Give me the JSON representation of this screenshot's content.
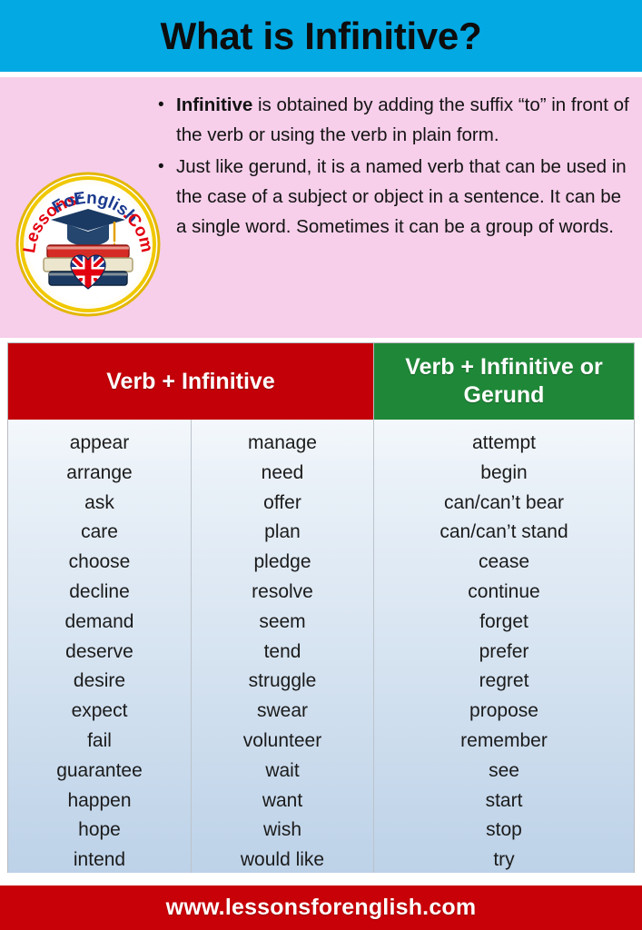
{
  "colors": {
    "title_banner_bg": "#03a9e3",
    "intro_bg": "#f7cfea",
    "header_infinitive_bg": "#c30008",
    "header_gerund_bg": "#1f8838",
    "footer_bg": "#c80007",
    "table_body_top": "#f4f8fc",
    "table_body_bottom": "#bdd2e8",
    "text_dark": "#131313",
    "text_white": "#ffffff"
  },
  "title": {
    "text": "What is Infinitive?"
  },
  "intro": {
    "bullet_glyph": "•",
    "bullets": [
      {
        "lead": "Infinitive",
        "rest": " is obtained by adding the suffix “to” in front of the verb or using the verb in plain form."
      },
      {
        "lead": "",
        "rest": "Just like gerund, it is a named verb that can be used in the case of a subject or object in a sentence. It can be a single word. Sometimes it can be a group of words."
      }
    ]
  },
  "logo": {
    "name": "lessons-for-english-logo",
    "text_red_1": "Lessons",
    "text_blue_1": "For",
    "text_blue_2": "English",
    "text_red_2": ".Com",
    "curved_label": "LessonsForEnglish.Com",
    "elements": [
      "graduation-cap-icon",
      "book-stack-icon",
      "uk-flag-heart-icon"
    ]
  },
  "table": {
    "headers": [
      {
        "label": "Verb + Infinitive",
        "color": "#c30008",
        "span": 2
      },
      {
        "label": "Verb + Infinitive or Gerund",
        "color": "#1f8838",
        "span": 1
      }
    ],
    "columns": [
      {
        "group": "Verb + Infinitive",
        "words": [
          "appear",
          "arrange",
          "ask",
          "care",
          "choose",
          "decline",
          "demand",
          "deserve",
          "desire",
          "expect",
          "fail",
          "guarantee",
          "happen",
          "hope",
          "intend"
        ]
      },
      {
        "group": "Verb + Infinitive",
        "words": [
          "manage",
          "need",
          "offer",
          "plan",
          "pledge",
          "resolve",
          "seem",
          "tend",
          "struggle",
          "swear",
          "volunteer",
          "wait",
          "want",
          "wish",
          "would like"
        ]
      },
      {
        "group": "Verb + Infinitive or Gerund",
        "words": [
          "attempt",
          "begin",
          "can/can’t bear",
          "can/can’t stand",
          "cease",
          "continue",
          "forget",
          "prefer",
          "regret",
          "propose",
          "remember",
          "see",
          "start",
          "stop",
          "try"
        ]
      }
    ]
  },
  "footer": {
    "url": "www.lessonsforenglish.com"
  }
}
